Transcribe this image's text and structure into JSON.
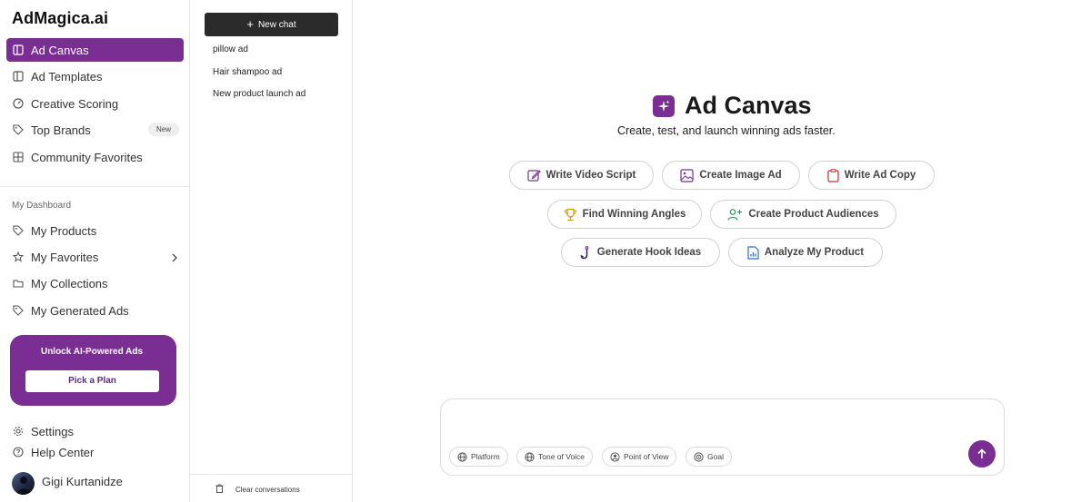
{
  "app": {
    "logo": "AdMagica.ai"
  },
  "sidebar": {
    "primary": [
      {
        "label": "Ad Canvas",
        "icon": "columns-icon",
        "active": true
      },
      {
        "label": "Ad Templates",
        "icon": "columns-icon"
      },
      {
        "label": "Creative Scoring",
        "icon": "gauge-icon"
      },
      {
        "label": "Top Brands",
        "icon": "tag-icon",
        "badge": "New"
      },
      {
        "label": "Community Favorites",
        "icon": "grid-icon"
      }
    ],
    "section_label": "My Dashboard",
    "dashboard": [
      {
        "label": "My Products",
        "icon": "tag-icon"
      },
      {
        "label": "My Favorites",
        "icon": "star-icon",
        "chevron": true
      },
      {
        "label": "My Collections",
        "icon": "folder-icon"
      },
      {
        "label": "My Generated Ads",
        "icon": "tag-icon"
      }
    ],
    "promo": {
      "title": "Unlock AI-Powered Ads",
      "button": "Pick a Plan"
    },
    "footer": [
      {
        "label": "Settings",
        "icon": "gear-icon"
      },
      {
        "label": "Help Center",
        "icon": "help-icon"
      }
    ],
    "user": {
      "name": "Gigi Kurtanidze"
    }
  },
  "history": {
    "new_chat": "New chat",
    "items": [
      "pillow ad",
      "Hair shampoo ad",
      "New product launch ad"
    ],
    "clear": "Clear conversations"
  },
  "main": {
    "title": "Ad Canvas",
    "subtitle": "Create, test, and launch winning ads faster.",
    "actions": [
      {
        "label": "Write Video Script",
        "icon": "edit-icon"
      },
      {
        "label": "Create Image Ad",
        "icon": "image-icon"
      },
      {
        "label": "Write Ad Copy",
        "icon": "clipboard-icon"
      },
      {
        "label": "Find Winning Angles",
        "icon": "trophy-icon"
      },
      {
        "label": "Create Product Audiences",
        "icon": "user-plus-icon"
      },
      {
        "label": "Generate Hook Ideas",
        "icon": "hook-icon"
      },
      {
        "label": "Analyze My Product",
        "icon": "file-chart-icon"
      }
    ],
    "composer": {
      "chips": [
        "Platform",
        "Tone of Voice",
        "Point of View",
        "Goal"
      ]
    }
  },
  "colors": {
    "accent": "#7a2e94",
    "dark_button": "#2b2b2b"
  }
}
